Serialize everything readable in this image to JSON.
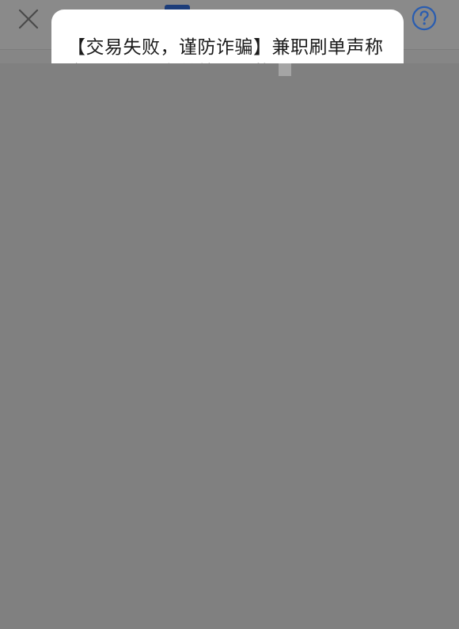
{
  "notification": {
    "text": "【交易失败，谨防诈骗】兼职刷单声称企业代付，多单统一返款"
  },
  "icons": {
    "close": "close-icon",
    "help": "help-circle-icon"
  },
  "colors": {
    "accent": "#1c3d7a",
    "help_icon": "#2a5db0",
    "overlay": "#808080"
  }
}
